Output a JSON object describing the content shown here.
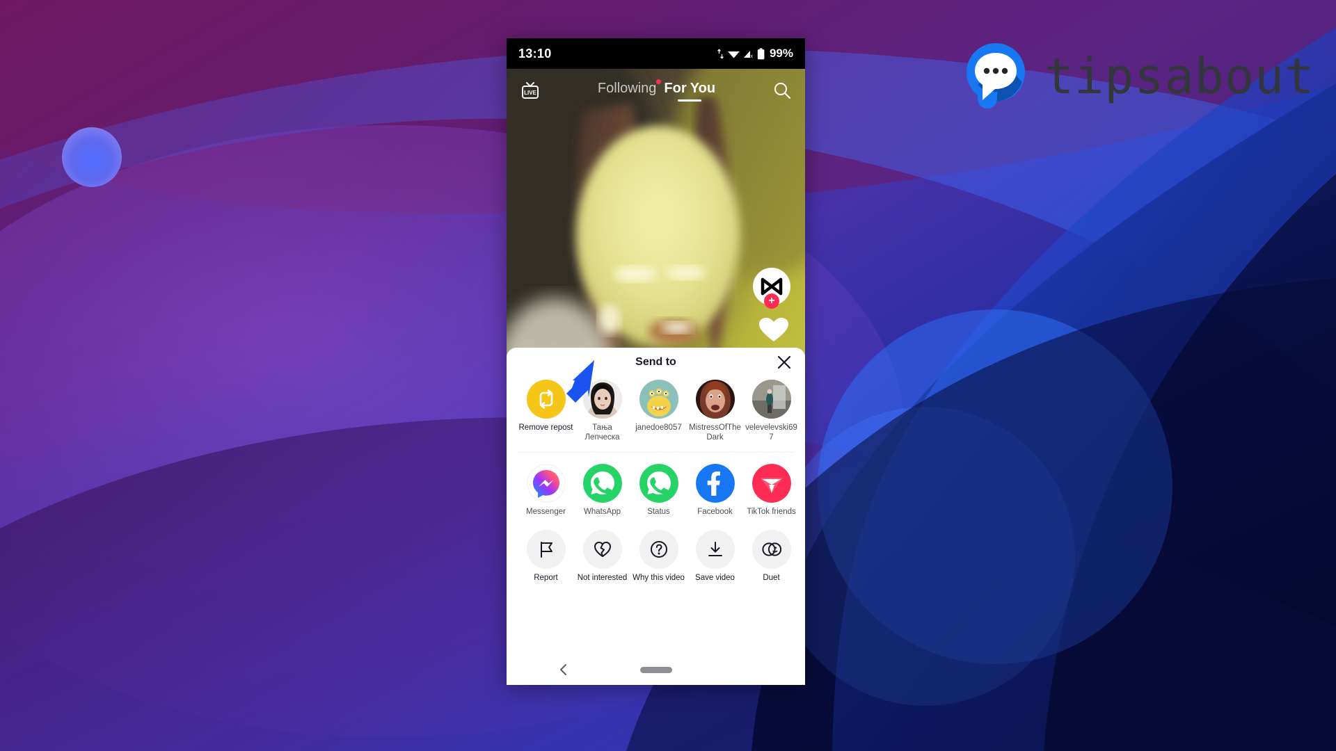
{
  "brand": {
    "name": "tipsabout",
    "logo_icon": "speech-bubble-logo-icon",
    "colors": {
      "circle": "#1877f2",
      "shadow": "#0b4ba8",
      "bubble": "#ffffff",
      "text": "#33363c"
    }
  },
  "background": {
    "colors": {
      "purple_dark": "#3d1052",
      "purple_mid": "#5b2a8f",
      "magenta": "#7a1f6b",
      "violet": "#6a52d9",
      "blue_bright": "#2f6bf5",
      "blue_deep": "#0b1048",
      "navy": "#070a33",
      "orb": "#5b6bff"
    }
  },
  "phone": {
    "statusbar": {
      "clock": "13:10",
      "battery_percent": "99%",
      "icons": [
        "data-transfer-icon",
        "wifi-icon",
        "signal-icon",
        "battery-icon"
      ]
    },
    "topnav": {
      "live_label": "LIVE",
      "live_icon": "live-tv-icon",
      "tabs": [
        {
          "label": "Following",
          "active": false,
          "has_dot": true
        },
        {
          "label": "For You",
          "active": true,
          "has_dot": false
        }
      ],
      "search_icon": "search-icon"
    },
    "video": {
      "capcut_icon": "capcut-logo-icon",
      "capcut_plus": "+",
      "like_icon": "heart-icon"
    },
    "navbar": {
      "back_icon": "chevron-left-icon",
      "gesture_pill": "home-gesture-pill"
    }
  },
  "share_sheet": {
    "title": "Send to",
    "close_icon": "close-icon",
    "contacts": [
      {
        "label": "Remove repost",
        "icon": "repost-icon",
        "type": "action",
        "color": "#f5c518"
      },
      {
        "label": "Тања Лепческа",
        "icon": "avatar",
        "type": "contact"
      },
      {
        "label": "janedoe8057",
        "icon": "avatar",
        "type": "contact"
      },
      {
        "label": "MistressOfTheDark",
        "icon": "avatar",
        "type": "contact"
      },
      {
        "label": "velevelevski697",
        "icon": "avatar",
        "type": "contact"
      }
    ],
    "apps": [
      {
        "label": "Messenger",
        "icon": "messenger-icon",
        "color": "#a334fa"
      },
      {
        "label": "WhatsApp",
        "icon": "whatsapp-icon",
        "color": "#25d366"
      },
      {
        "label": "Status",
        "icon": "whatsapp-status-icon",
        "color": "#25d366"
      },
      {
        "label": "Facebook",
        "icon": "facebook-icon",
        "color": "#1877f2"
      },
      {
        "label": "TikTok friends",
        "icon": "tiktok-friends-icon",
        "color": "#fe2c55"
      }
    ],
    "actions": [
      {
        "label": "Report",
        "icon": "flag-icon"
      },
      {
        "label": "Not interested",
        "icon": "broken-heart-icon"
      },
      {
        "label": "Why this video",
        "icon": "question-mark-icon"
      },
      {
        "label": "Save video",
        "icon": "download-icon"
      },
      {
        "label": "Duet",
        "icon": "duet-icon"
      }
    ]
  },
  "annotation": {
    "arrow_icon": "pointer-arrow-icon",
    "arrow_color": "#1a53f0",
    "points_to": "Remove repost"
  }
}
